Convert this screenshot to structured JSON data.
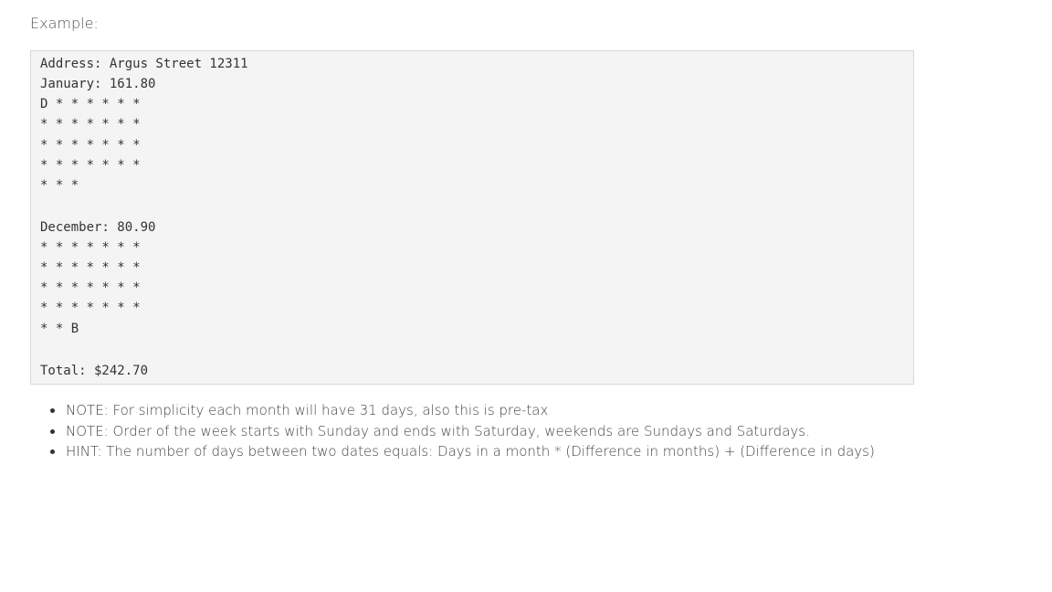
{
  "intro": "Example:",
  "code_lines": [
    "Address: Argus Street 12311",
    "January: 161.80",
    "D * * * * * *",
    "* * * * * * *",
    "* * * * * * *",
    "* * * * * * *",
    "* * *",
    "",
    "December: 80.90",
    "* * * * * * *",
    "* * * * * * *",
    "* * * * * * *",
    "* * * * * * *",
    "* * B",
    "",
    "Total: $242.70"
  ],
  "notes": [
    "NOTE: For simplicity each month will have 31 days, also this is pre-tax",
    "NOTE: Order of the week starts with Sunday and ends with Saturday, weekends are Sundays and Saturdays.",
    "HINT: The number of days between two dates equals: Days in a month * (Difference in months) + (Difference in days)"
  ]
}
